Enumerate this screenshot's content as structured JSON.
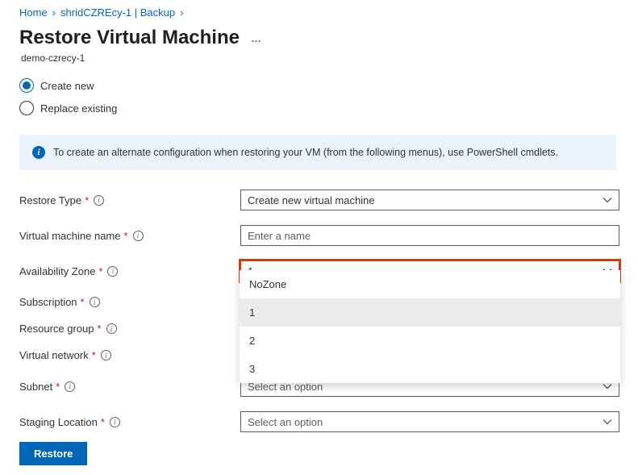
{
  "breadcrumb": {
    "home": "Home",
    "vault": "shridCZREcy-1 | Backup"
  },
  "page": {
    "title": "Restore Virtual Machine",
    "subtitle": "demo-czrecy-1"
  },
  "radio": {
    "create_new": "Create new",
    "replace_existing": "Replace existing"
  },
  "banner": {
    "text": "To create an alternate configuration when restoring your VM (from the following menus), use PowerShell cmdlets."
  },
  "fields": {
    "restore_type": {
      "label": "Restore Type",
      "value": "Create new virtual machine"
    },
    "vm_name": {
      "label": "Virtual machine name",
      "placeholder": "Enter a name"
    },
    "availability_zone": {
      "label": "Availability Zone",
      "value": "1",
      "options": [
        "NoZone",
        "1",
        "2",
        "3"
      ]
    },
    "subscription": {
      "label": "Subscription"
    },
    "resource_group": {
      "label": "Resource group"
    },
    "virtual_network": {
      "label": "Virtual network"
    },
    "subnet": {
      "label": "Subnet",
      "value": "Select an option"
    },
    "staging_location": {
      "label": "Staging Location",
      "value": "Select an option"
    }
  },
  "footer": {
    "restore": "Restore"
  }
}
